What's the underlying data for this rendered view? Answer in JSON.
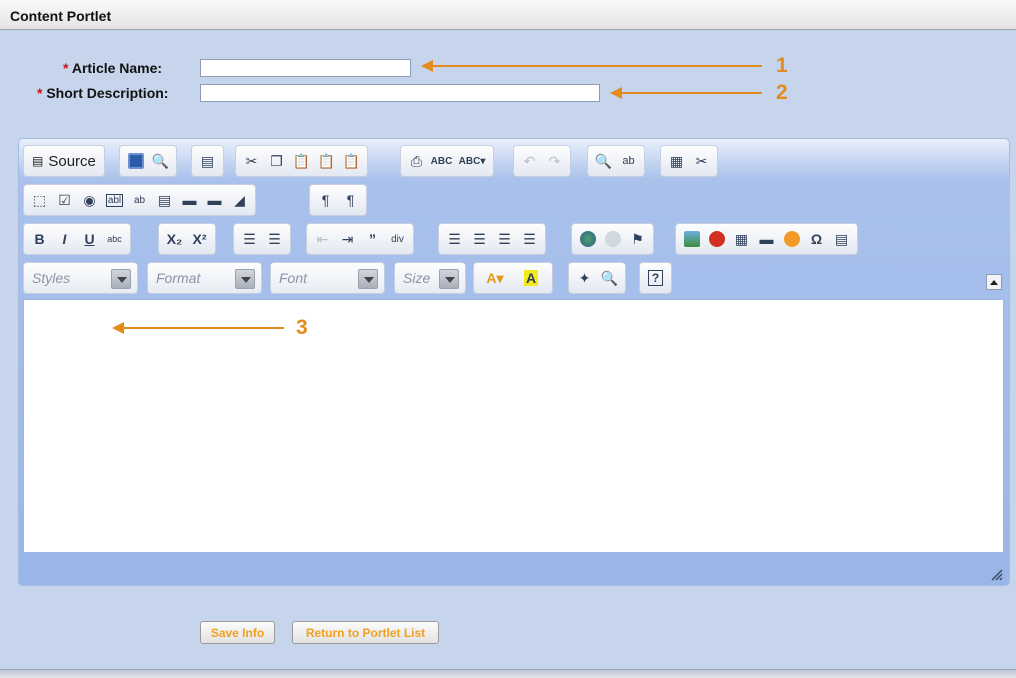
{
  "portlet": {
    "title": "Content Portlet"
  },
  "form": {
    "article_name": {
      "required_mark": "*",
      "label": "Article Name:",
      "value": ""
    },
    "short_description": {
      "required_mark": "*",
      "label": "Short Description:",
      "value": ""
    }
  },
  "callouts": [
    "1",
    "2",
    "3"
  ],
  "toolbar": {
    "source_label": "Source",
    "styles_label": "Styles",
    "format_label": "Format",
    "font_label": "Font",
    "size_label": "Size",
    "button_icons": [
      "source-icon",
      "save-icon",
      "preview-icon",
      "templates-icon",
      "cut-icon",
      "copy-icon",
      "paste-icon",
      "paste-text-icon",
      "paste-word-icon",
      "print-icon",
      "spellcheck-icon",
      "spellcheck-as-you-type-icon",
      "undo-icon",
      "redo-icon",
      "find-icon",
      "replace-icon",
      "select-all-icon",
      "remove-format-icon",
      "form-icon",
      "checkbox-icon",
      "radio-icon",
      "textfield-icon",
      "textarea-icon",
      "select-icon",
      "button-icon",
      "image-button-icon",
      "hidden-field-icon",
      "bidi-ltr-icon",
      "bidi-rtl-icon",
      "bold-icon",
      "italic-icon",
      "underline-icon",
      "strike-icon",
      "subscript-icon",
      "superscript-icon",
      "numbered-list-icon",
      "bulleted-list-icon",
      "outdent-icon",
      "indent-icon",
      "blockquote-icon",
      "div-icon",
      "align-left-icon",
      "align-center-icon",
      "align-right-icon",
      "justify-icon",
      "link-icon",
      "unlink-icon",
      "anchor-icon",
      "image-icon",
      "flash-icon",
      "table-icon",
      "horizontal-rule-icon",
      "smiley-icon",
      "special-char-icon",
      "page-break-icon",
      "text-color-icon",
      "bg-color-icon",
      "maximize-icon",
      "show-blocks-icon",
      "about-icon"
    ]
  },
  "editor": {
    "content": ""
  },
  "actions": {
    "save_label": "Save Info",
    "return_label": "Return to Portlet List"
  },
  "colors": {
    "accent": "#e58a1c",
    "background": "#c6d4ec",
    "editor_band": "#9ab5e8",
    "required": "#cc1111"
  }
}
